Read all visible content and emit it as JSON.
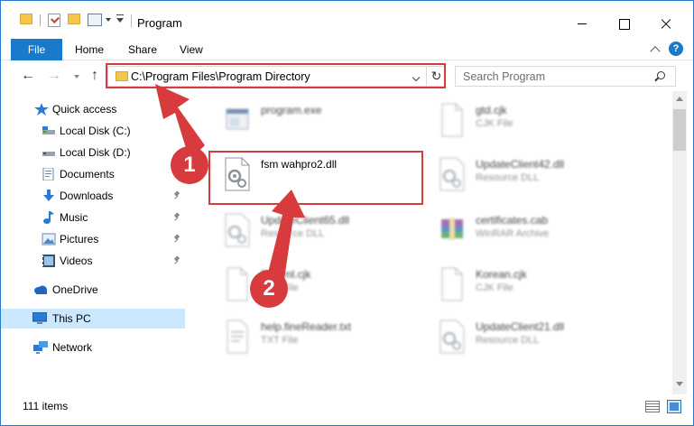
{
  "window": {
    "title": "Program"
  },
  "ribbon": {
    "file": "File",
    "home": "Home",
    "share": "Share",
    "view": "View",
    "help": "?"
  },
  "nav": {
    "address": "C:\\Program Files\\Program Directory",
    "search_placeholder": "Search Program",
    "back": "←",
    "forward": "→",
    "up": "↑",
    "refresh": "↻"
  },
  "sidebar": {
    "items": [
      {
        "label": "Quick access",
        "icon": "star-icon"
      },
      {
        "label": "Local Disk (C:)",
        "icon": "drive-icon"
      },
      {
        "label": "Local Disk (D:)",
        "icon": "drive-icon"
      },
      {
        "label": "Documents",
        "icon": "documents-icon",
        "pinned": true
      },
      {
        "label": "Downloads",
        "icon": "download-icon",
        "pinned": true
      },
      {
        "label": "Music",
        "icon": "music-icon",
        "pinned": true
      },
      {
        "label": "Pictures",
        "icon": "pictures-icon",
        "pinned": true
      },
      {
        "label": "Videos",
        "icon": "videos-icon",
        "pinned": true
      },
      {
        "label": "OneDrive",
        "icon": "cloud-icon"
      },
      {
        "label": "This PC",
        "icon": "computer-icon",
        "selected": true
      },
      {
        "label": "Network",
        "icon": "network-icon"
      }
    ]
  },
  "files": [
    {
      "name": "program.exe",
      "type": "",
      "icon": "exe-icon",
      "blurred": true
    },
    {
      "name": "gtd.cjk",
      "type": "CJK File",
      "icon": "file-icon",
      "blurred": true
    },
    {
      "name": "fsm wahpro2.dll",
      "type": "",
      "icon": "dll-icon",
      "blurred": false
    },
    {
      "name": "UpdateClient42.dll",
      "type": "Resource DLL",
      "icon": "dll-icon",
      "blurred": true
    },
    {
      "name": "UpdateClient65.dll",
      "type": "Resource DLL",
      "icon": "dll-icon",
      "blurred": true
    },
    {
      "name": "certificates.cab",
      "type": "WinRAR Archive",
      "icon": "archive-icon",
      "blurred": true
    },
    {
      "name": "Enhtml.cjk",
      "type": "CJK File",
      "icon": "file-icon",
      "blurred": true
    },
    {
      "name": "Korean.cjk",
      "type": "CJK File",
      "icon": "file-icon",
      "blurred": true
    },
    {
      "name": "help.fineReader.txt",
      "type": "TXT File",
      "icon": "txt-icon",
      "blurred": true
    },
    {
      "name": "UpdateClient21.dll",
      "type": "Resource DLL",
      "icon": "dll-icon",
      "blurred": true
    }
  ],
  "status": {
    "count": "111 items"
  },
  "annotations": {
    "step1": "1",
    "step2": "2",
    "color": "#d73b3e"
  }
}
